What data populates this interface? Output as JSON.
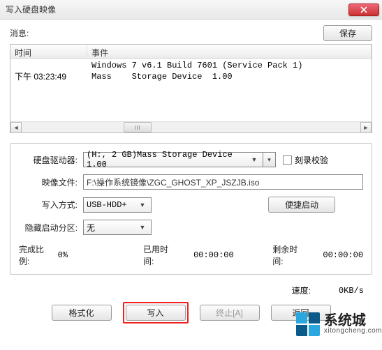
{
  "window": {
    "title": "写入硬盘映像"
  },
  "header": {
    "message_label": "消息:",
    "save_label": "保存"
  },
  "table": {
    "col_time": "时间",
    "col_event": "事件",
    "rows": [
      {
        "time": "",
        "event": "Windows 7 v6.1 Build 7601 (Service Pack 1)"
      },
      {
        "time": "下午 03:23:49",
        "event": "Mass    Storage Device  1.00"
      }
    ]
  },
  "form": {
    "drive_label": "硬盘驱动器:",
    "drive_value": "(H:, 2 GB)Mass    Storage Device  1.00",
    "burn_check_label": "刻录校验",
    "image_label": "映像文件:",
    "image_value": "F:\\操作系统镜像\\ZGC_GHOST_XP_JSZJB.iso",
    "write_mode_label": "写入方式:",
    "write_mode_value": "USB-HDD+",
    "quick_boot_label": "便捷启动",
    "hide_label": "隐藏启动分区:",
    "hide_value": "无",
    "progress_label": "完成比例:",
    "progress_value": "0%",
    "elapsed_label": "已用时间:",
    "elapsed_value": "00:00:00",
    "remain_label": "剩余时间:",
    "remain_value": "00:00:00"
  },
  "speed": {
    "label": "速度:",
    "value": "0KB/s"
  },
  "buttons": {
    "format": "格式化",
    "write": "写入",
    "abort": "终止[A]",
    "back": "返回"
  },
  "watermark": {
    "cn": "系统城",
    "en": "xitongcheng.com"
  }
}
